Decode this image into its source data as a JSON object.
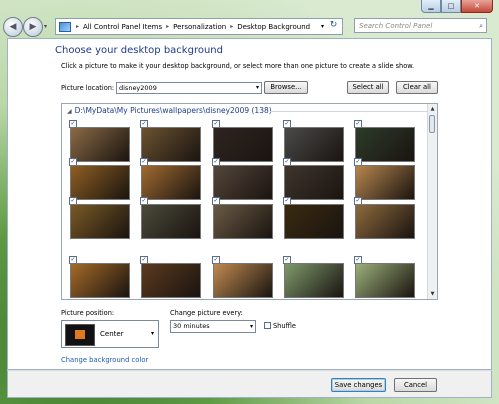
{
  "window": {
    "minimize_label": "▁",
    "maximize_label": "□",
    "close_label": "✕"
  },
  "nav": {
    "back_label": "◀",
    "forward_label": "▶",
    "recent_label": "▾",
    "breadcrumb": [
      "All Control Panel Items",
      "Personalization",
      "Desktop Background"
    ],
    "breadcrumb_sep": "▸",
    "address_dropdown": "▾",
    "refresh_label": "↻",
    "search_placeholder": "Search Control Panel",
    "search_icon": "⌕"
  },
  "main": {
    "heading": "Choose your desktop background",
    "instruction": "Click a picture to make it your desktop background, or select more than one picture to create a slide show.",
    "picture_location_label": "Picture location:",
    "picture_location_value": "disney2009",
    "browse_label": "Browse...",
    "select_all_label": "Select all",
    "clear_all_label": "Clear all",
    "group_header": "D:\\MyData\\My Pictures\\wallpapers\\disney2009 (138)",
    "thumbnails": [
      {
        "row": 0,
        "col": 0,
        "color": "#8a6a45"
      },
      {
        "row": 0,
        "col": 1,
        "color": "#6b5232"
      },
      {
        "row": 0,
        "col": 2,
        "color": "#2e2520"
      },
      {
        "row": 0,
        "col": 3,
        "color": "#4a4a4a"
      },
      {
        "row": 0,
        "col": 4,
        "color": "#2d3b2a"
      },
      {
        "row": 1,
        "col": 0,
        "color": "#8f5f22"
      },
      {
        "row": 1,
        "col": 1,
        "color": "#a06a30"
      },
      {
        "row": 1,
        "col": 2,
        "color": "#54453a"
      },
      {
        "row": 1,
        "col": 3,
        "color": "#3f352d"
      },
      {
        "row": 1,
        "col": 4,
        "color": "#b7864f"
      },
      {
        "row": 2,
        "col": 0,
        "color": "#7a5a25"
      },
      {
        "row": 2,
        "col": 1,
        "color": "#4b4a3a"
      },
      {
        "row": 2,
        "col": 2,
        "color": "#6a5a45"
      },
      {
        "row": 2,
        "col": 3,
        "color": "#3a2a10"
      },
      {
        "row": 2,
        "col": 4,
        "color": "#8d6a3d"
      },
      {
        "row": 3,
        "col": 0,
        "color": "#a56a28"
      },
      {
        "row": 3,
        "col": 1,
        "color": "#5c3a1e"
      },
      {
        "row": 3,
        "col": 2,
        "color": "#c08a50"
      },
      {
        "row": 3,
        "col": 3,
        "color": "#7e9a6a"
      },
      {
        "row": 3,
        "col": 4,
        "color": "#9bb07a"
      }
    ],
    "checked_mark": "✓",
    "scroll_up": "▲",
    "scroll_down": "▼",
    "picture_position_label": "Picture position:",
    "picture_position_value": "Center",
    "change_every_label": "Change picture every:",
    "change_every_value": "30 minutes",
    "shuffle_label": "Shuffle",
    "change_color_link": "Change background color",
    "combo_arrow": "▾"
  },
  "footer": {
    "save_label": "Save changes",
    "cancel_label": "Cancel"
  }
}
